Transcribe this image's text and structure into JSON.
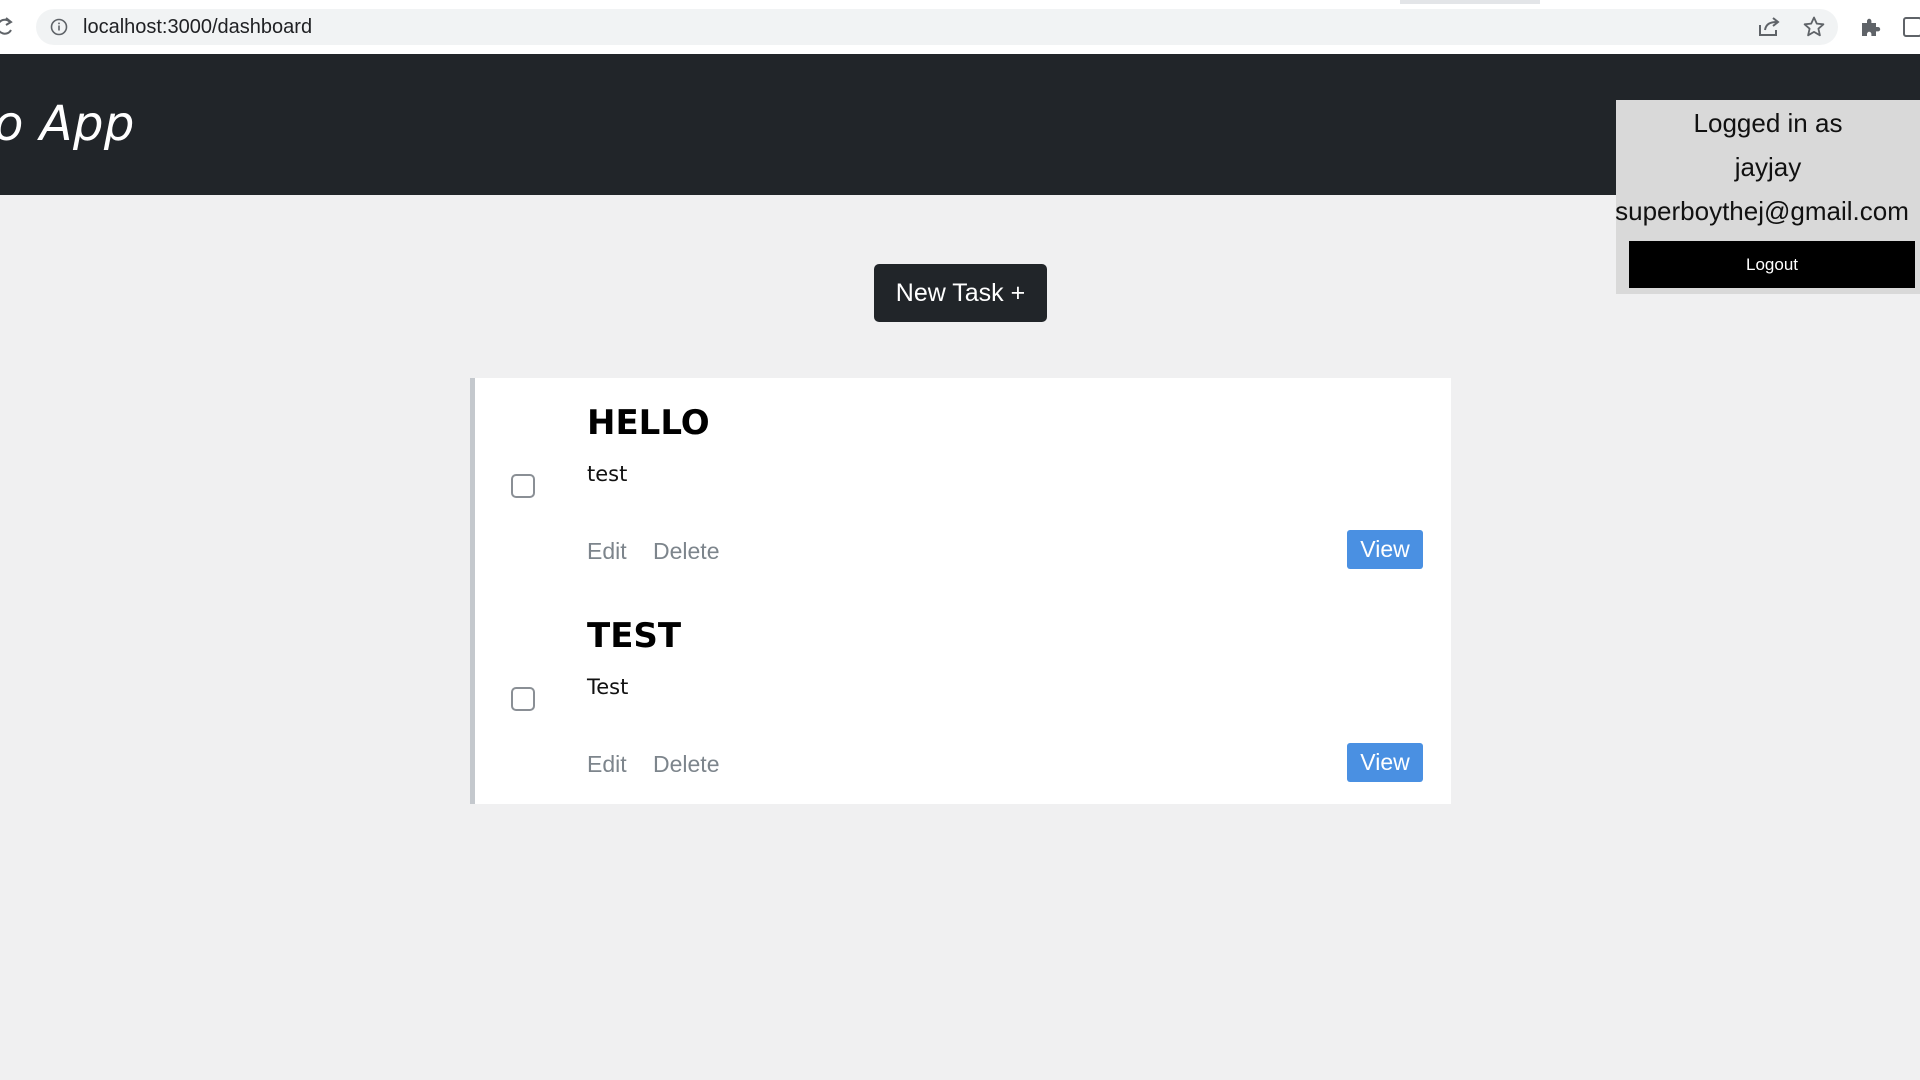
{
  "browser": {
    "url": "localhost:3000/dashboard"
  },
  "header": {
    "title": "o App"
  },
  "user": {
    "logged_in_label": "Logged in as",
    "username": "jayjay",
    "email": "superboythej@gmail.com",
    "logout_label": "Logout"
  },
  "actions": {
    "new_task_label": "New Task +"
  },
  "tasks": [
    {
      "title": "HELLO",
      "description": "test",
      "edit_label": "Edit",
      "delete_label": "Delete",
      "view_label": "View",
      "completed": false
    },
    {
      "title": "TEST",
      "description": "Test",
      "edit_label": "Edit",
      "delete_label": "Delete",
      "view_label": "View",
      "completed": false
    }
  ],
  "colors": {
    "header_bg": "#212529",
    "page_bg": "#f0f0f1",
    "view_button": "#4a90e2",
    "logout_button": "#000000",
    "user_panel_bg": "#d9d9d9"
  },
  "icons": {
    "reload": "reload-icon",
    "info": "info-icon",
    "share": "share-icon",
    "bookmark": "star-icon",
    "extensions": "puzzle-icon",
    "side_panel": "side-panel-icon"
  }
}
